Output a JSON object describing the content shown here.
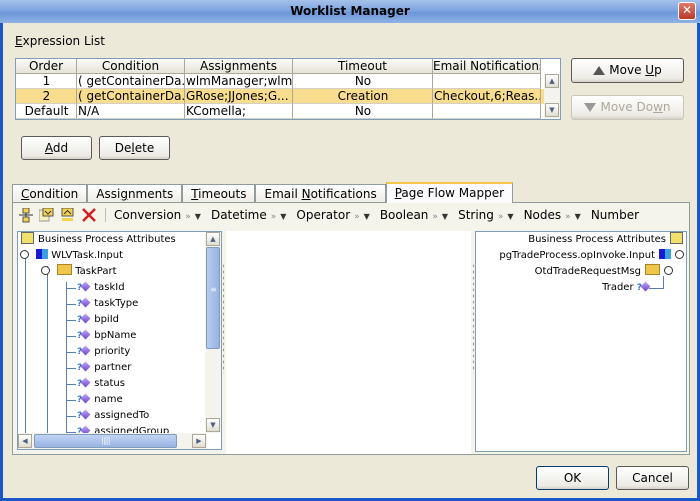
{
  "window": {
    "title": "Worklist Manager",
    "close_icon": "close-icon"
  },
  "expression_list": {
    "label_prefix": "E",
    "label_rest": "xpression List",
    "columns": [
      "Order",
      "Condition",
      "Assignments",
      "Timeout",
      "Email Notifications"
    ],
    "rows": [
      {
        "order": "1",
        "condition": "( getContainerDa...",
        "assignments": "wlmManager;wlm...",
        "timeout": "No",
        "email": ""
      },
      {
        "order": "2",
        "condition": "( getContainerDa...",
        "assignments": "GRose;JJones;G...",
        "timeout": "Creation",
        "email": "Checkout,6;Reas...",
        "selected": true
      },
      {
        "order": "Default",
        "condition": "N/A",
        "assignments": "KComella;",
        "timeout": "No",
        "email": ""
      }
    ],
    "selected_row_color": "#f8dd8e"
  },
  "buttons": {
    "move_up": {
      "pre": "Move ",
      "mn": "U",
      "post": "p"
    },
    "move_down": {
      "pre": "Move Do",
      "mn": "w",
      "post": "n",
      "disabled": true
    },
    "add": {
      "pre": "",
      "mn": "A",
      "post": "dd"
    },
    "delete": {
      "pre": "De",
      "mn": "l",
      "post": "ete"
    },
    "ok": "OK",
    "cancel": "Cancel"
  },
  "tabs": [
    {
      "pre": "",
      "mn": "C",
      "post": "ondition"
    },
    {
      "pre": "Assi",
      "mn": "g",
      "post": "nments"
    },
    {
      "pre": "",
      "mn": "T",
      "post": "imeouts"
    },
    {
      "pre": "Email ",
      "mn": "N",
      "post": "otifications"
    },
    {
      "pre": "",
      "mn": "P",
      "post": "age Flow Mapper",
      "active": true
    }
  ],
  "toolbar": {
    "icons": [
      "expand-tree-icon",
      "collapse-down-icon",
      "collapse-up-icon",
      "delete-icon"
    ],
    "menus": [
      "Conversion",
      "Datetime",
      "Operator",
      "Boolean",
      "String",
      "Nodes",
      "Number"
    ]
  },
  "left_tree": {
    "root": "Business Process Attributes",
    "input": "WLVTask.Input",
    "part": "TaskPart",
    "fields": [
      "taskId",
      "taskType",
      "bpiId",
      "bpName",
      "priority",
      "partner",
      "status",
      "name",
      "assignedTo",
      "assignedGroup"
    ]
  },
  "right_tree": {
    "root": "Business Process Attributes",
    "input": "pgTradeProcess.opInvoke.Input",
    "msg": "OtdTradeRequestMsg",
    "field": "Trader"
  }
}
